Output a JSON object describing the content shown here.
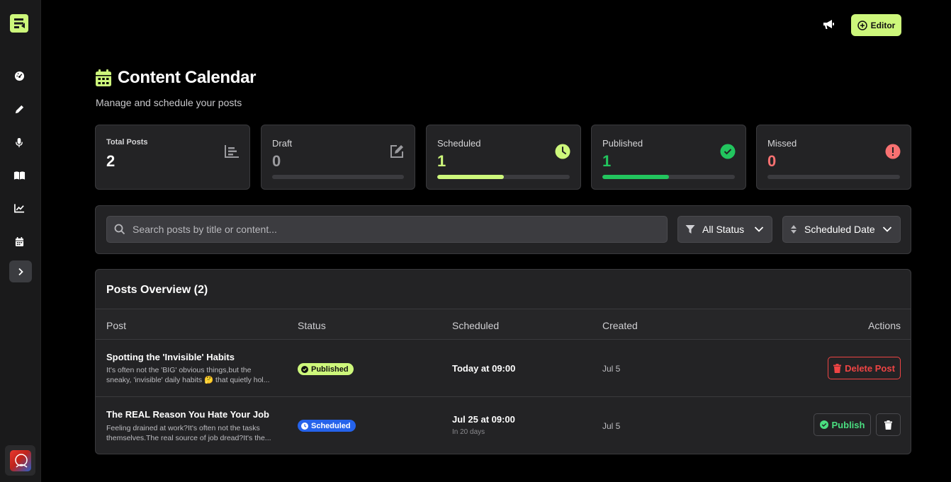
{
  "sidebar": {
    "items": [
      {
        "icon": "dashboard-icon"
      },
      {
        "icon": "pencil-icon"
      },
      {
        "icon": "microphone-icon"
      },
      {
        "icon": "book-icon"
      },
      {
        "icon": "chart-line-icon"
      },
      {
        "icon": "calendar-icon"
      }
    ],
    "expand_icon": "chevron-right-icon"
  },
  "topbar": {
    "announcements_icon": "megaphone-icon",
    "editor_label": "Editor"
  },
  "header": {
    "title": "Content Calendar",
    "subtitle": "Manage and schedule your posts"
  },
  "stats": [
    {
      "label": "Total Posts",
      "value": "2",
      "icon": "chart-bar-icon"
    },
    {
      "label": "Draft",
      "value": "0",
      "icon": "edit-icon",
      "progress": 0
    },
    {
      "label": "Scheduled",
      "value": "1",
      "icon": "clock-icon",
      "progress": 0.5
    },
    {
      "label": "Published",
      "value": "1",
      "icon": "check-circle-icon",
      "progress": 0.5
    },
    {
      "label": "Missed",
      "value": "0",
      "icon": "alert-circle-icon",
      "progress": 0
    }
  ],
  "filters": {
    "search_placeholder": "Search posts by title or content...",
    "status_value": "All Status",
    "sort_value": "Scheduled Date"
  },
  "table": {
    "title": "Posts Overview (2)",
    "columns": [
      "Post",
      "Status",
      "Scheduled",
      "Created",
      "Actions"
    ],
    "rows": [
      {
        "title": "Spotting the 'Invisible' Habits",
        "excerpt_line1": "It's often not the 'BIG' obvious things,but the",
        "excerpt_line2": "sneaky, 'invisible' daily habits 🤔 that quietly hol...",
        "status": "Published",
        "scheduled": "Today at 09:00",
        "created": "Jul 5",
        "action": "Delete Post"
      },
      {
        "title": "The REAL Reason You Hate Your Job",
        "excerpt_line1": "Feeling drained at work?It's often not the tasks",
        "excerpt_line2": "themselves.The real source of job dread?It's the...",
        "status": "Scheduled",
        "scheduled": "Jul 25 at 09:00",
        "scheduled_sub": "In 20 days",
        "created": "Jul 5",
        "action": "Publish"
      }
    ]
  },
  "colors": {
    "accent": "#cdf77b",
    "published": "#22c55e",
    "scheduled": "#2563eb",
    "missed": "#f87171",
    "delete": "#ef4444"
  }
}
